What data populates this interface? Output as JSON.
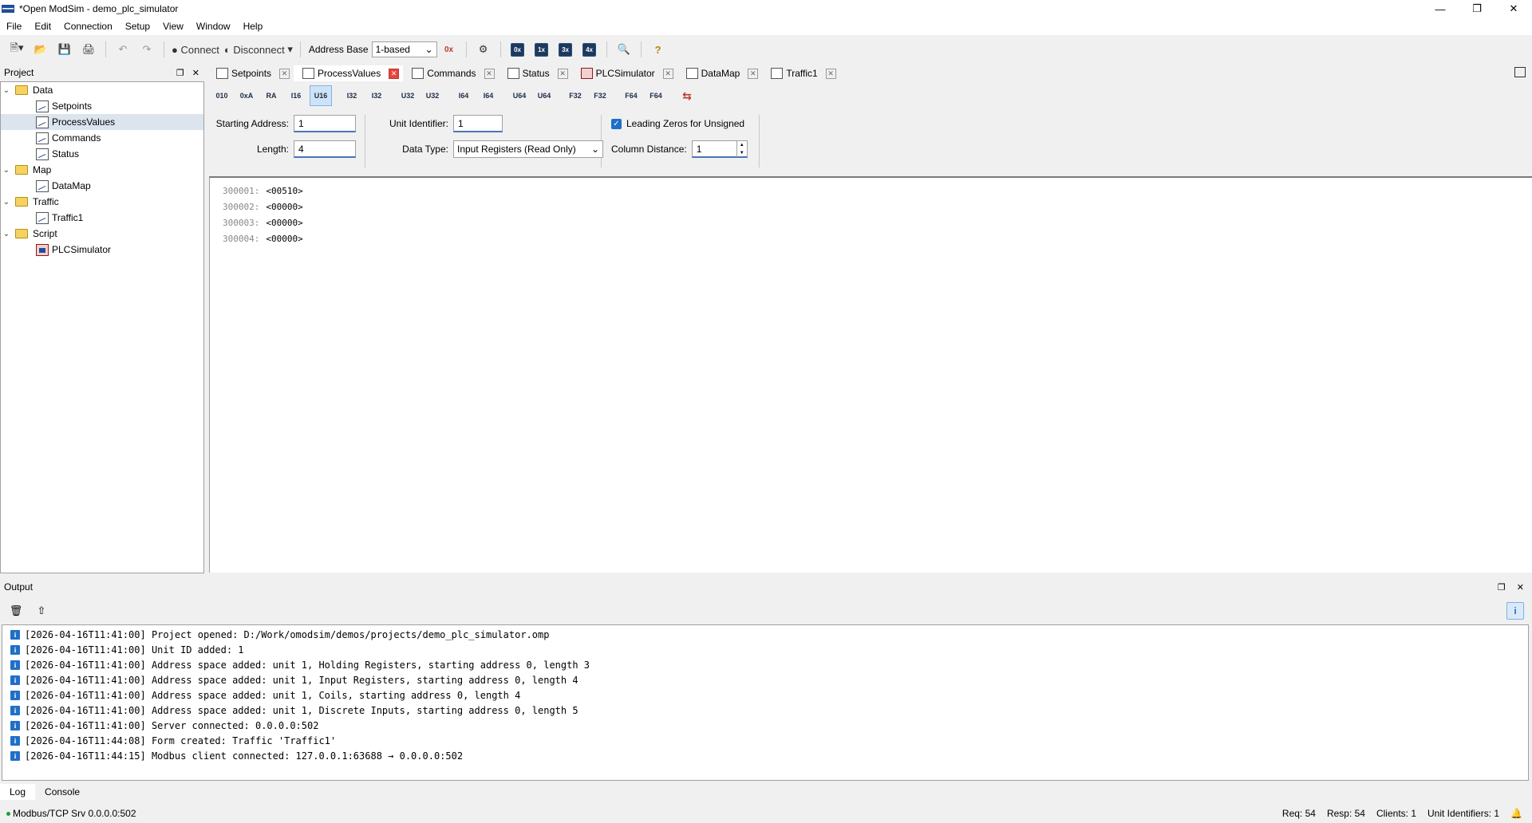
{
  "window": {
    "title": "*Open ModSim - demo_plc_simulator"
  },
  "menu": [
    "File",
    "Edit",
    "Connection",
    "Setup",
    "View",
    "Window",
    "Help"
  ],
  "toolbar": {
    "connect_label": "Connect",
    "disconnect_label": "Disconnect",
    "address_base_label": "Address Base",
    "address_base_value": "1-based",
    "icons": [
      "new-icon",
      "open-icon",
      "save-icon",
      "print-icon",
      "undo-icon",
      "redo-icon"
    ],
    "mini_buttons": [
      "0x",
      "1x",
      "3x",
      "4x"
    ]
  },
  "project": {
    "title": "Project",
    "tree": [
      {
        "label": "Data",
        "type": "folder"
      },
      {
        "label": "Setpoints",
        "type": "doc"
      },
      {
        "label": "ProcessValues",
        "type": "doc",
        "selected": true
      },
      {
        "label": "Commands",
        "type": "doc"
      },
      {
        "label": "Status",
        "type": "doc"
      },
      {
        "label": "Map",
        "type": "folder"
      },
      {
        "label": "DataMap",
        "type": "doc"
      },
      {
        "label": "Traffic",
        "type": "folder"
      },
      {
        "label": "Traffic1",
        "type": "doc"
      },
      {
        "label": "Script",
        "type": "folder"
      },
      {
        "label": "PLCSimulator",
        "type": "script"
      }
    ]
  },
  "tabs": [
    {
      "label": "Setpoints",
      "active": false
    },
    {
      "label": "ProcessValues",
      "active": true
    },
    {
      "label": "Commands",
      "active": false
    },
    {
      "label": "Status",
      "active": false
    },
    {
      "label": "PLCSimulator",
      "active": false
    },
    {
      "label": "DataMap",
      "active": false
    },
    {
      "label": "Traffic1",
      "active": false
    }
  ],
  "format_buttons": [
    "010",
    "0xA",
    "RA",
    "I16",
    "U16",
    "I32",
    "I32",
    "U32",
    "U32",
    "I64",
    "I64",
    "U64",
    "U64",
    "F32",
    "F32",
    "F64",
    "F64",
    "SWAP"
  ],
  "settings": {
    "starting_address_label": "Starting Address:",
    "starting_address_value": "1",
    "length_label": "Length:",
    "length_value": "4",
    "unit_identifier_label": "Unit Identifier:",
    "unit_identifier_value": "1",
    "data_type_label": "Data Type:",
    "data_type_value": "Input Registers (Read Only)",
    "leading_zeros_label": "Leading Zeros for Unsigned",
    "leading_zeros_checked": true,
    "column_distance_label": "Column Distance:",
    "column_distance_value": "1"
  },
  "registers": [
    {
      "address": "300001:",
      "value": "<00510>"
    },
    {
      "address": "300002:",
      "value": "<00000>"
    },
    {
      "address": "300003:",
      "value": "<00000>"
    },
    {
      "address": "300004:",
      "value": "<00000>"
    }
  ],
  "output": {
    "title": "Output",
    "log": [
      "[2026-04-16T11:41:00] Project opened: D:/Work/omodsim/demos/projects/demo_plc_simulator.omp",
      "[2026-04-16T11:41:00] Unit ID added: 1",
      "[2026-04-16T11:41:00] Address space added: unit 1, Holding Registers, starting address 0, length 3",
      "[2026-04-16T11:41:00] Address space added: unit 1, Input Registers, starting address 0, length 4",
      "[2026-04-16T11:41:00] Address space added: unit 1, Coils, starting address 0, length 4",
      "[2026-04-16T11:41:00] Address space added: unit 1, Discrete Inputs, starting address 0, length 5",
      "[2026-04-16T11:41:00] Server connected: 0.0.0.0:502",
      "[2026-04-16T11:44:08] Form created: Traffic 'Traffic1'",
      "[2026-04-16T11:44:15] Modbus client connected: 127.0.0.1:63688 → 0.0.0.0:502"
    ],
    "tabs": [
      "Log",
      "Console"
    ]
  },
  "status": {
    "server": "Modbus/TCP Srv 0.0.0.0:502",
    "req": "Req: 54",
    "resp": "Resp: 54",
    "clients": "Clients: 1",
    "unit_identifiers": "Unit Identifiers: 1"
  }
}
